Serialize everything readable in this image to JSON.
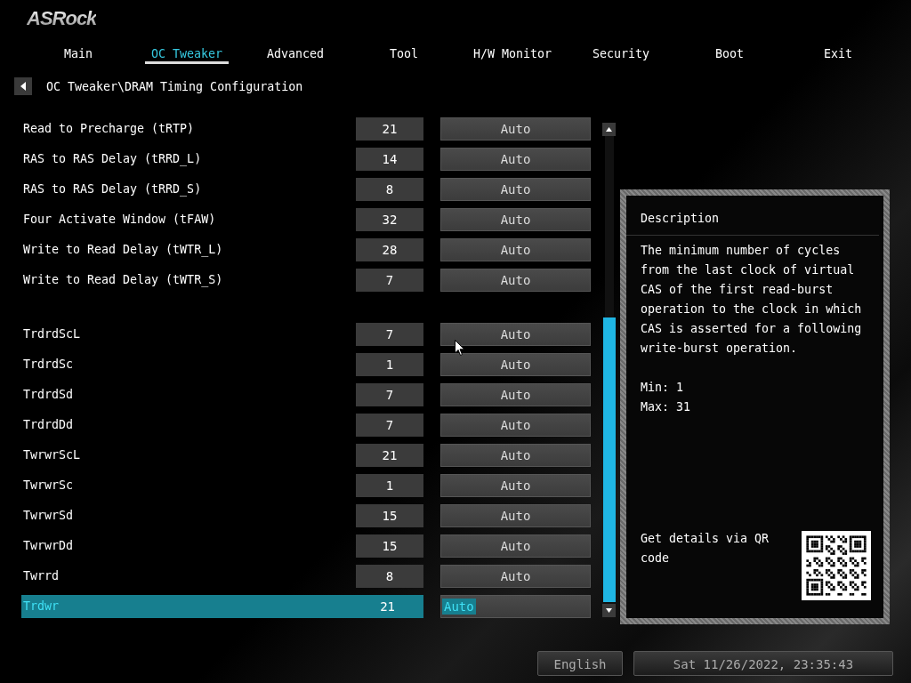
{
  "logo": "ASRock",
  "tabs": [
    {
      "label": "Main",
      "selected": false
    },
    {
      "label": "OC Tweaker",
      "selected": true
    },
    {
      "label": "Advanced",
      "selected": false
    },
    {
      "label": "Tool",
      "selected": false
    },
    {
      "label": "H/W Monitor",
      "selected": false
    },
    {
      "label": "Security",
      "selected": false
    },
    {
      "label": "Boot",
      "selected": false
    },
    {
      "label": "Exit",
      "selected": false
    }
  ],
  "breadcrumb": "OC Tweaker\\DRAM Timing Configuration",
  "groups": [
    {
      "rows": [
        {
          "label": "Read to Precharge (tRTP)",
          "value": "21",
          "mode": "Auto",
          "selected": false
        },
        {
          "label": "RAS to RAS Delay (tRRD_L)",
          "value": "14",
          "mode": "Auto",
          "selected": false
        },
        {
          "label": "RAS to RAS Delay (tRRD_S)",
          "value": "8",
          "mode": "Auto",
          "selected": false
        },
        {
          "label": "Four Activate Window (tFAW)",
          "value": "32",
          "mode": "Auto",
          "selected": false
        },
        {
          "label": "Write to Read Delay (tWTR_L)",
          "value": "28",
          "mode": "Auto",
          "selected": false
        },
        {
          "label": "Write to Read Delay (tWTR_S)",
          "value": "7",
          "mode": "Auto",
          "selected": false
        }
      ]
    },
    {
      "rows": [
        {
          "label": "TrdrdScL",
          "value": "7",
          "mode": "Auto",
          "selected": false
        },
        {
          "label": "TrdrdSc",
          "value": "1",
          "mode": "Auto",
          "selected": false
        },
        {
          "label": "TrdrdSd",
          "value": "7",
          "mode": "Auto",
          "selected": false
        },
        {
          "label": "TrdrdDd",
          "value": "7",
          "mode": "Auto",
          "selected": false
        },
        {
          "label": "TwrwrScL",
          "value": "21",
          "mode": "Auto",
          "selected": false
        },
        {
          "label": "TwrwrSc",
          "value": "1",
          "mode": "Auto",
          "selected": false
        },
        {
          "label": "TwrwrSd",
          "value": "15",
          "mode": "Auto",
          "selected": false
        },
        {
          "label": "TwrwrDd",
          "value": "15",
          "mode": "Auto",
          "selected": false
        },
        {
          "label": "Twrrd",
          "value": "8",
          "mode": "Auto",
          "selected": false
        },
        {
          "label": "Trdwr",
          "value": "21",
          "mode": "Auto",
          "selected": true
        }
      ]
    }
  ],
  "description": {
    "title": "Description",
    "text": "The minimum number of cycles from the last clock of virtual CAS of the first read-burst operation to the clock in which CAS is asserted for a following write-burst operation.",
    "range": [
      "Min: 1",
      "Max: 31"
    ],
    "qr_caption": "Get details via QR code"
  },
  "status_bar": {
    "language": "English",
    "datetime": "Sat 11/26/2022, 23:35:43"
  }
}
